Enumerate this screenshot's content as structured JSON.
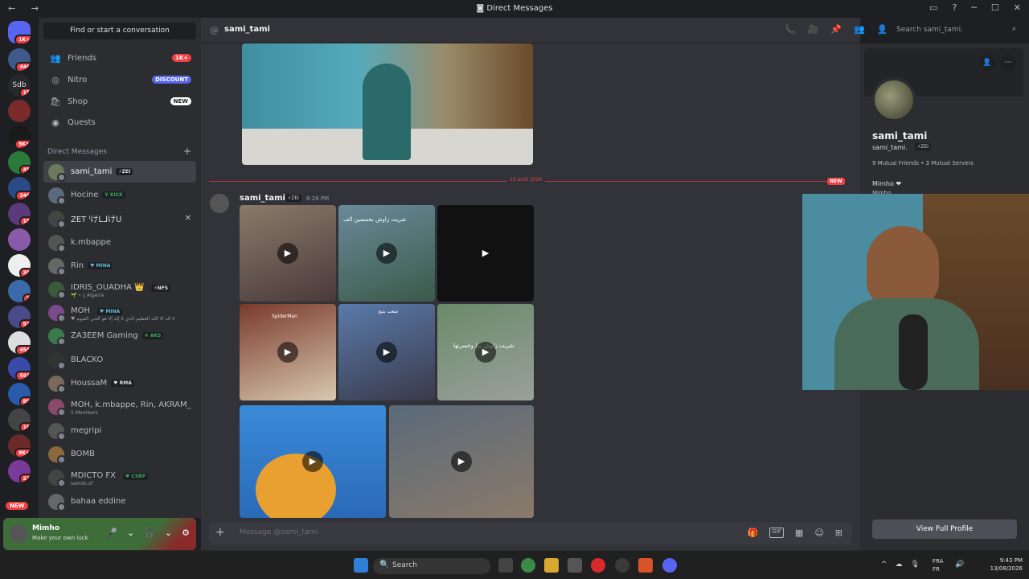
{
  "window": {
    "title": "Direct Messages",
    "nav_arrows": "← →",
    "controls": [
      "▭",
      "?",
      "─",
      "☐",
      "✕"
    ]
  },
  "guilds": [
    {
      "badge": "1K+"
    },
    {
      "badge": "446"
    },
    {
      "label": "Sdb",
      "badge": "15"
    },
    {
      "badge": ""
    },
    {
      "badge": "9K+"
    },
    {
      "badge": "45"
    },
    {
      "badge": "246"
    },
    {
      "badge": "18"
    },
    {
      "badge": ""
    },
    {
      "badge": "30"
    },
    {
      "badge": "2"
    },
    {
      "badge": "91"
    },
    {
      "badge": "454"
    },
    {
      "badge": "593"
    },
    {
      "badge": "85"
    },
    {
      "badge": "16"
    },
    {
      "badge": "8K+"
    },
    {
      "badge": "22"
    },
    {
      "badge": "NEW"
    }
  ],
  "sidebar": {
    "find_button": "Find or start a conversation",
    "nav": [
      {
        "icon": "👥",
        "label": "Friends",
        "pill": "1K+",
        "pill_color": "#f23f43"
      },
      {
        "icon": "◎",
        "label": "Nitro",
        "pill": "DISCOUNT",
        "pill_color": "#5865f2"
      },
      {
        "icon": "🛍",
        "label": "Shop",
        "pill": "NEW",
        "pill_color": "#5865f2"
      },
      {
        "icon": "◉",
        "label": "Quests",
        "pill": "",
        "pill_color": ""
      }
    ],
    "dm_header": "Direct Messages",
    "dm_plus": "+",
    "dms": [
      {
        "name": "sami_tami",
        "tag": "⚡ZEI",
        "sub": "",
        "color": "#6a7a5a"
      },
      {
        "name": "Hocine",
        "tag": "Y KICK",
        "sub": "",
        "color": "#5a6a7a"
      },
      {
        "name": "ZET ᑊけᒪᒧけᑌ",
        "tag": "",
        "sub": "",
        "color": "#444"
      },
      {
        "name": "k.mbappe",
        "tag": "",
        "sub": "",
        "color": "#555"
      },
      {
        "name": "Rin",
        "tag": "♥ MINA",
        "sub": "",
        "color": "#666"
      },
      {
        "name": "IDRIS_OUADHA 👑",
        "tag": "⚡NFS",
        "sub": "🌱 • ▯ Algeria",
        "color": "#3a5a3a"
      },
      {
        "name": "MOH",
        "tag": "♥ MINA",
        "sub": "♥ لا اله الا الله العظيم الذي لا إله إلا هو الحي القيوم",
        "color": "#7a4a8a"
      },
      {
        "name": "ZA3EEM Gaming",
        "tag": "❦ AKS",
        "sub": "",
        "color": "#3a7a4a"
      },
      {
        "name": "BLACKO",
        "tag": "",
        "sub": "",
        "color": "#333"
      },
      {
        "name": "HoussaM",
        "tag": "♥ RMA",
        "sub": "",
        "color": "#7a6a5a"
      },
      {
        "name": "MOH, k.mbappe, Rin, AKRAM_...",
        "tag": "",
        "sub": "5 Members",
        "color": "#8a4a6a"
      },
      {
        "name": "megripi",
        "tag": "",
        "sub": "",
        "color": "#555"
      },
      {
        "name": "BOMB",
        "tag": "",
        "sub": "",
        "color": "#8a6a3a"
      },
      {
        "name": "MDICTO FX",
        "tag": "♥ CSRP",
        "sub": "samdx.xf",
        "color": "#444"
      },
      {
        "name": "bahaa eddine",
        "tag": "",
        "sub": "",
        "color": "#666"
      }
    ],
    "close_icon": "✕"
  },
  "user_panel": {
    "name": "Mimho",
    "status": "Make your own luck",
    "controls": [
      "🎤",
      "⌄",
      "🎧",
      "⌄",
      "⚙"
    ]
  },
  "chat": {
    "recipient": "sami_tami",
    "search_placeholder": "Search sami_tami.",
    "header_icons": [
      "📞",
      "🎥",
      "📌",
      "👥",
      "👤"
    ],
    "divider_date": "13 août 2026",
    "new_label": "NEW",
    "message": {
      "author": "sami_tami",
      "tag": "⚡ZEI",
      "time": "8:26 PM"
    },
    "composer_placeholder": "Message @sami_tami",
    "composer_icons": [
      "🎁",
      "GIF",
      "▦",
      "☺",
      "⊞"
    ],
    "play_icon": "▶",
    "thumb_texts": [
      "شريت زاوش بخمسين الف",
      "SpiderMan",
      "شعب بتبع",
      "شريت زاوش برا وخسرتها"
    ]
  },
  "profile": {
    "name": "sami_tami",
    "username": "sami_tami.",
    "tag": "⚡ZEI",
    "mutual": "9 Mutual Friends • 3 Mutual Servers",
    "bio": "Mimho ❤",
    "bio_sub": "Mimho...",
    "view_full": "View Full Profile",
    "buttons": [
      "👤",
      "⋯"
    ]
  },
  "taskbar": {
    "search": "Search",
    "search_icon": "🔍",
    "tray": [
      "^",
      "☁",
      "🎙"
    ],
    "lang_top": "FRA",
    "lang_bottom": "FR",
    "time": "9:43 PM",
    "date": "13/08/2026"
  }
}
